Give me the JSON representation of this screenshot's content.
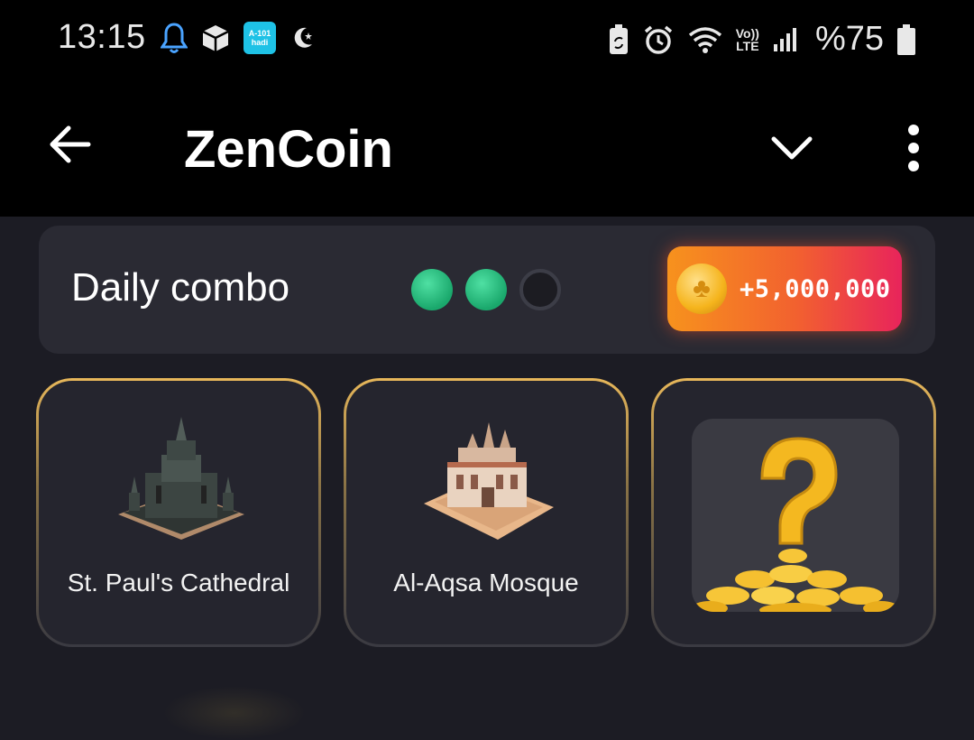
{
  "status_bar": {
    "time": "13:15",
    "battery_percent": "%75",
    "left_icons": [
      "bell-icon",
      "package-icon",
      "a101-app-icon",
      "moon-star-icon"
    ],
    "a101_label_top": "A-101",
    "a101_label_bottom": "hadi",
    "right_icons": [
      "battery-saver-icon",
      "alarm-icon",
      "wifi-icon",
      "volte-icon",
      "signal-icon",
      "battery-icon"
    ],
    "volte_label_top": "Vo))",
    "volte_label_bottom": "LTE"
  },
  "app_bar": {
    "title": "ZenCoin",
    "back_icon": "arrow-left-icon",
    "collapse_icon": "chevron-down-icon",
    "menu_icon": "more-vertical-icon"
  },
  "daily_combo": {
    "title": "Daily combo",
    "found": 2,
    "total": 3,
    "reward": "+5,000,000",
    "colors": {
      "found_dot": "#22c17f",
      "reward_start": "#f7921d",
      "reward_end": "#e8245b"
    }
  },
  "combo_cards": [
    {
      "label": "St. Paul's Cathedral",
      "image": "cathedral-image"
    },
    {
      "label": "Al-Aqsa Mosque",
      "image": "mosque-image"
    },
    {
      "label": "",
      "image": "mystery-coins-image"
    }
  ]
}
